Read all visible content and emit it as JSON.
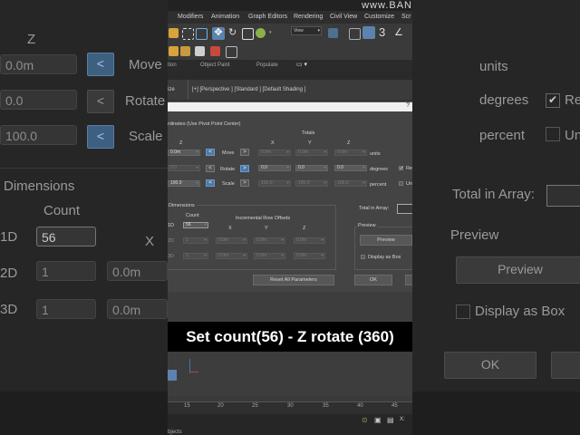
{
  "app": {
    "brand": "www.BAN"
  },
  "menu": [
    "Modifiers",
    "Animation",
    "Graph Editors",
    "Rendering",
    "Civil View",
    "Customize",
    "Scr"
  ],
  "toolbar": {
    "view_dropdown": "View"
  },
  "ribbon": {
    "tab1": "tion",
    "tab2": "Object Paint",
    "tab3": "Populate"
  },
  "viewport": {
    "left_label": "ize",
    "label": "[+] [Perspective ] [Standard ] [Default Shading ]"
  },
  "dialog": {
    "close": "?",
    "section_title": "rdinates (Use Pivot Point Center)",
    "totals_label": "Totals",
    "incremental": {
      "z_header": "Z",
      "z_move": "0.0m",
      "z_rotate": "0.0",
      "z_scale": "100.0"
    },
    "ops": {
      "move": "Move",
      "rotate": "Rotate",
      "scale": "Scale"
    },
    "totals": {
      "x_header": "X",
      "y_header": "Y",
      "z_header": "Z",
      "move": [
        "0.0m",
        "0.0m",
        "0.0m"
      ],
      "rotate": [
        "0.0",
        "0.0",
        "0.0"
      ],
      "scale": [
        "100.0",
        "100.0",
        "100.0"
      ]
    },
    "units": {
      "move": "units",
      "rotate": "degrees",
      "scale": "percent"
    },
    "right_checks": {
      "re": "Re",
      "un": "Un"
    },
    "dimensions": {
      "title": "Dimensions",
      "count_header": "Count",
      "row_offsets_header": "Incremental Row Offsets",
      "x": "X",
      "y": "Y",
      "z": "Z",
      "rows": [
        {
          "label": "1D",
          "count": "56",
          "x": "",
          "y": "",
          "z": ""
        },
        {
          "label": "2D",
          "count": "1",
          "x": "0.0m",
          "y": "0.0m",
          "z": "0.0m"
        },
        {
          "label": "3D",
          "count": "1",
          "x": "0.0m",
          "y": "0.0m",
          "z": "0.0m"
        }
      ]
    },
    "total_in_array_label": "Total in Array:",
    "preview_group": "Preview",
    "preview_button": "Preview",
    "display_as_box": "Display as Box",
    "reset_button": "Reset All Parameters",
    "ok_button": "OK"
  },
  "timeline": {
    "ticks": [
      "15",
      "20",
      "25",
      "30",
      "35",
      "40",
      "45"
    ]
  },
  "status": {
    "left": "bjects",
    "x_label": "X:"
  },
  "caption": "Set  count(56) - Z rotate (360)",
  "background_zoom": {
    "z": "Z",
    "move_val": "0.0m",
    "rotate_val": "0.0",
    "scale_val": "100.0",
    "move": "Move",
    "rotate": "Rotate",
    "scale": "Scale",
    "dimensions": "Dimensions",
    "count": "Count",
    "x": "X",
    "d1": "1D",
    "d2": "2D",
    "d3": "3D",
    "c1": "56",
    "c2": "1",
    "c3": "1",
    "off": "0.0m",
    "units": "units",
    "degrees": "degrees",
    "percent": "percent",
    "re": "Re",
    "un": "Un",
    "total": "Total in Array:",
    "preview_label": "Preview",
    "preview_btn": "Preview",
    "display_box": "Display as Box",
    "ok": "OK"
  },
  "colors": {
    "accent_blue": "#4a7aa5",
    "caption_bg": "#000000"
  }
}
